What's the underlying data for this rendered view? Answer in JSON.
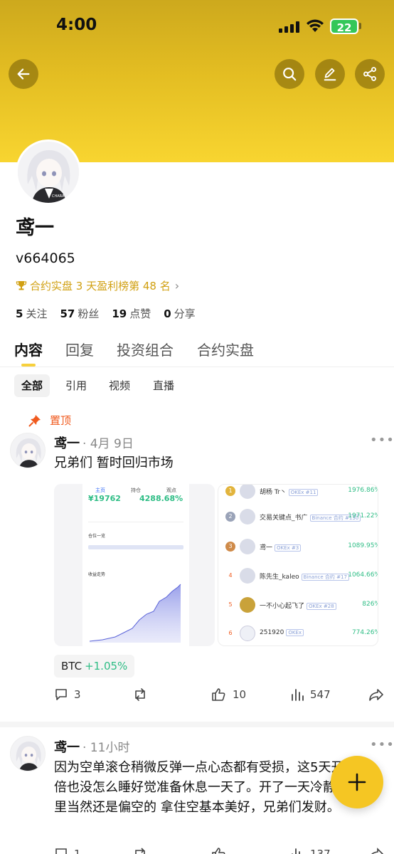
{
  "status": {
    "time": "4:00",
    "battery": "22"
  },
  "profile": {
    "name": "鸢一",
    "uid": "v664065",
    "rank_text": "合约实盘 3 天盈利榜第 48 名",
    "stats": [
      {
        "value": "5",
        "label": "关注"
      },
      {
        "value": "57",
        "label": "粉丝"
      },
      {
        "value": "19",
        "label": "点赞"
      },
      {
        "value": "0",
        "label": "分享"
      }
    ]
  },
  "tabs": [
    "内容",
    "回复",
    "投资组合",
    "合约实盘"
  ],
  "filters": [
    "全部",
    "引用",
    "视频",
    "直播"
  ],
  "pinned_label": "置顶",
  "post1": {
    "author": "鸢一",
    "time": "· 4月 9日",
    "text": "兄弟们 暂时回归市场",
    "tag_symbol": "BTC",
    "tag_change": "+1.05%",
    "comments": "3",
    "likes": "10",
    "views": "547",
    "card1": {
      "tabs": [
        "主页",
        "持仓",
        "观点"
      ],
      "balance": "¥19762",
      "return": "4288.68%",
      "section1": "仓位一览",
      "section2": "收益走势"
    },
    "ranking": [
      {
        "rank": "1",
        "name": "胡杨 Tr丶",
        "badge": "OKEx #11",
        "pct": "1976.86%"
      },
      {
        "rank": "2",
        "name": "交易关键点_书广",
        "badge": "Binance 合约 #130",
        "pct": "1971.22%"
      },
      {
        "rank": "3",
        "name": "鸢一",
        "badge": "OKEx #3",
        "pct": "1089.95%"
      },
      {
        "rank": "4",
        "name": "陈先生_kaleo",
        "badge": "Binance 合约 #17",
        "pct": "1064.66%"
      },
      {
        "rank": "5",
        "name": "一不小心起飞了",
        "badge": "OKEx #28",
        "pct": "826%"
      },
      {
        "rank": "6",
        "name": "251920",
        "badge": "OKEx",
        "pct": "774.26%"
      }
    ]
  },
  "post2": {
    "author": "鸢一",
    "time": "· 11小时",
    "text": "因为空单滚仓稍微反弹一点心态都有受损，这5天开了20倍也没怎么睡好觉准备休息一天了。开了一天冷静期。这里当然还是偏空的 拿住空基本美好，兄弟们发财。",
    "comments": "1",
    "views": "137"
  },
  "colors": {
    "accent": "#f5c623",
    "up": "#2ebd85",
    "pin": "#f05a1e",
    "rank": "#d1a012"
  }
}
